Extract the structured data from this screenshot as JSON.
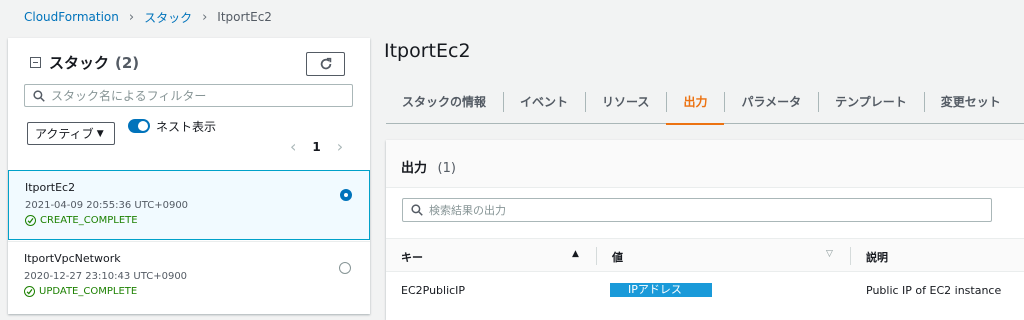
{
  "breadcrumb": {
    "root": "CloudFormation",
    "parent": "スタック",
    "current": "ItportEc2"
  },
  "left_panel": {
    "title": "スタック",
    "count": "(2)",
    "filter_placeholder": "スタック名によるフィルター",
    "select_value": "アクティブ",
    "toggle_label": "ネスト表示",
    "page": "1",
    "stacks": [
      {
        "name": "ItportEc2",
        "time": "2021-04-09 20:55:36 UTC+0900",
        "status": "CREATE_COMPLETE",
        "selected": true
      },
      {
        "name": "ItportVpcNetwork",
        "time": "2020-12-27 23:10:43 UTC+0900",
        "status": "UPDATE_COMPLETE",
        "selected": false
      }
    ]
  },
  "main": {
    "title": "ItportEc2",
    "tabs": [
      "スタックの情報",
      "イベント",
      "リソース",
      "出力",
      "パラメータ",
      "テンプレート",
      "変更セット"
    ],
    "active_tab": "出力",
    "outputs": {
      "title": "出力",
      "count": "(1)",
      "search_placeholder": "検索結果の出力",
      "columns": {
        "key": "キー",
        "value": "値",
        "description": "説明"
      },
      "rows": [
        {
          "key": "EC2PublicIP",
          "value": "IPアドレス",
          "description": "Public IP of EC2 instance"
        }
      ]
    }
  },
  "colors": {
    "link": "#0073bb",
    "accent": "#ec7211",
    "success": "#1d8102",
    "highlight": "#1a9ad9"
  },
  "icons": [
    "refresh-icon",
    "search-icon",
    "chevron-left-icon",
    "chevron-right-icon",
    "check-circle-icon",
    "sort-asc-icon",
    "sort-desc-icon",
    "collapse-icon"
  ]
}
